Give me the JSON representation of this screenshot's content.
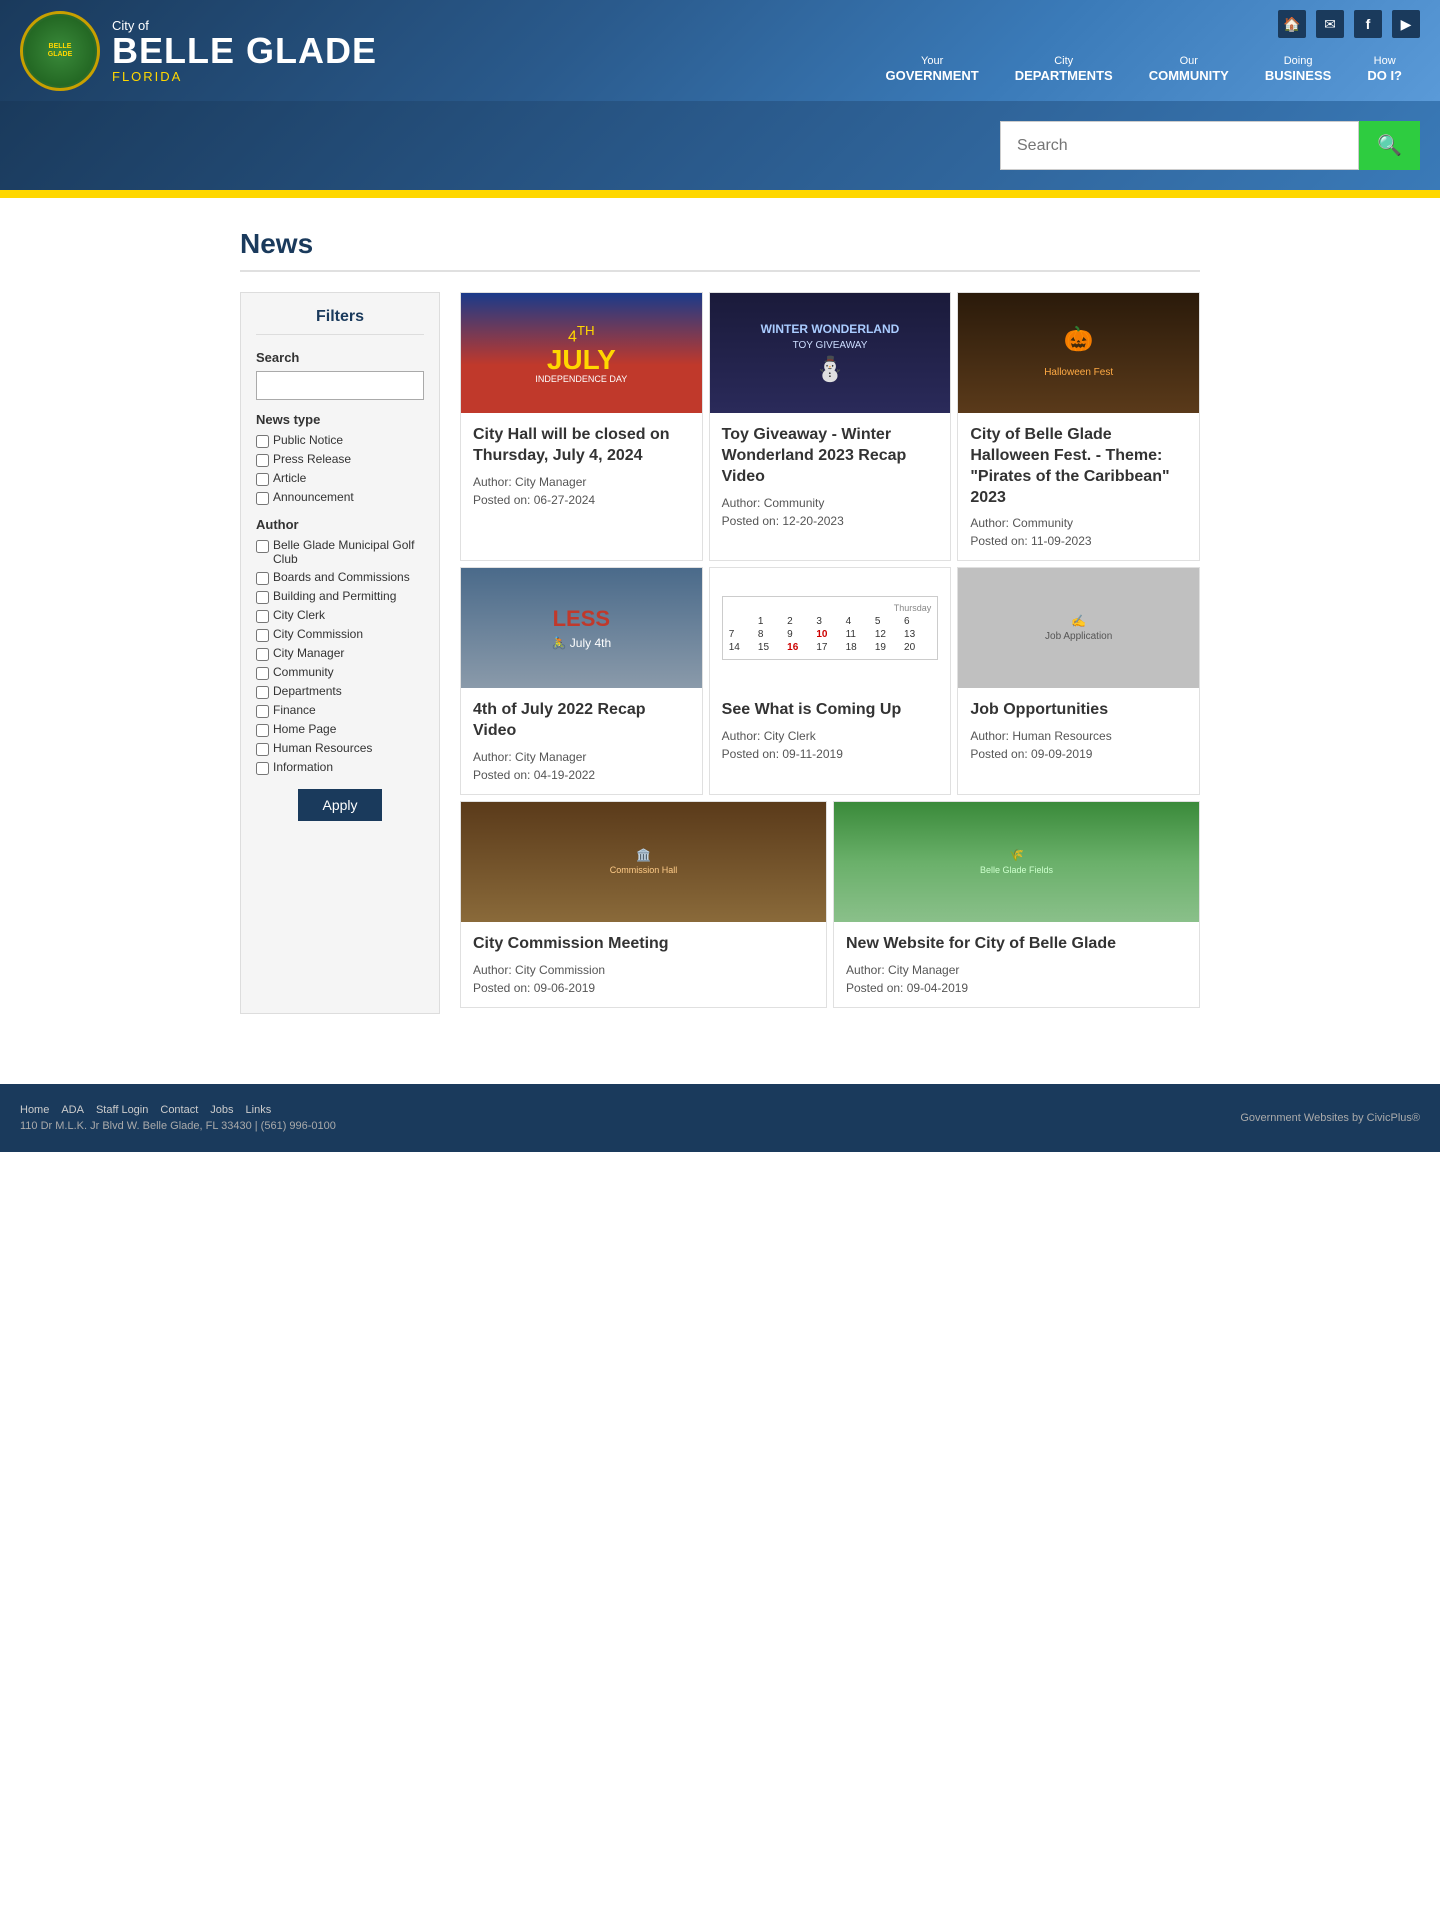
{
  "header": {
    "city_of": "City of",
    "belle_glade": "BELLE GLADE",
    "florida": "FLORIDA",
    "logo_text": "BELLE GLADE",
    "icons": [
      {
        "name": "home-icon",
        "symbol": "🏠"
      },
      {
        "name": "email-icon",
        "symbol": "✉"
      },
      {
        "name": "facebook-icon",
        "symbol": "f"
      },
      {
        "name": "youtube-icon",
        "symbol": "▶"
      }
    ],
    "nav": [
      {
        "label": "Your",
        "bold": "GOVERNMENT"
      },
      {
        "label": "City",
        "bold": "DEPARTMENTS"
      },
      {
        "label": "Our",
        "bold": "COMMUNITY"
      },
      {
        "label": "Doing",
        "bold": "BUSINESS"
      },
      {
        "label": "How",
        "bold": "DO I?"
      }
    ]
  },
  "search": {
    "placeholder": "Search",
    "button_label": "🔍"
  },
  "page_title": "News",
  "sidebar": {
    "title": "Filters",
    "search_label": "Search",
    "search_placeholder": "",
    "news_type_label": "News type",
    "news_types": [
      "Public Notice",
      "Press Release",
      "Article",
      "Announcement"
    ],
    "author_label": "Author",
    "authors": [
      "Belle Glade Municipal Golf Club",
      "Boards and Commissions",
      "Building and Permitting",
      "City Clerk",
      "City Commission",
      "City Manager",
      "Community",
      "Departments",
      "Finance",
      "Home Page",
      "Human Resources",
      "Information"
    ],
    "apply_button": "Apply"
  },
  "news_items": [
    {
      "id": 1,
      "title": "City Hall will be closed on Thursday, July 4, 2024",
      "author": "City Manager",
      "posted": "06-27-2024",
      "img_type": "4th-july"
    },
    {
      "id": 2,
      "title": "Toy Giveaway - Winter Wonderland 2023 Recap Video",
      "author": "Community",
      "posted": "12-20-2023",
      "img_type": "winter"
    },
    {
      "id": 3,
      "title": "City of Belle Glade Halloween Fest. - Theme: \"Pirates of the Caribbean\" 2023",
      "author": "Community",
      "posted": "11-09-2023",
      "img_type": "halloween"
    },
    {
      "id": 4,
      "title": "4th of July 2022 Recap Video",
      "author": "City Manager",
      "posted": "04-19-2022",
      "img_type": "july2022"
    },
    {
      "id": 5,
      "title": "See What is Coming Up",
      "author": "City Clerk",
      "posted": "09-11-2019",
      "img_type": "calendar"
    },
    {
      "id": 6,
      "title": "Job Opportunities",
      "author": "Human Resources",
      "posted": "09-09-2019",
      "img_type": "job"
    },
    {
      "id": 7,
      "title": "City Commission Meeting",
      "author": "City Commission",
      "posted": "09-06-2019",
      "img_type": "commission"
    },
    {
      "id": 8,
      "title": "New Website for City of Belle Glade",
      "author": "City Manager",
      "posted": "09-04-2019",
      "img_type": "website"
    }
  ],
  "footer": {
    "links": [
      "Home",
      "ADA",
      "Staff Login",
      "Contact",
      "Jobs",
      "Links"
    ],
    "address": "110 Dr M.L.K. Jr Blvd W. Belle Glade, FL 33430 | (561) 996-0100",
    "powered_by": "Government Websites by CivicPlus®"
  }
}
